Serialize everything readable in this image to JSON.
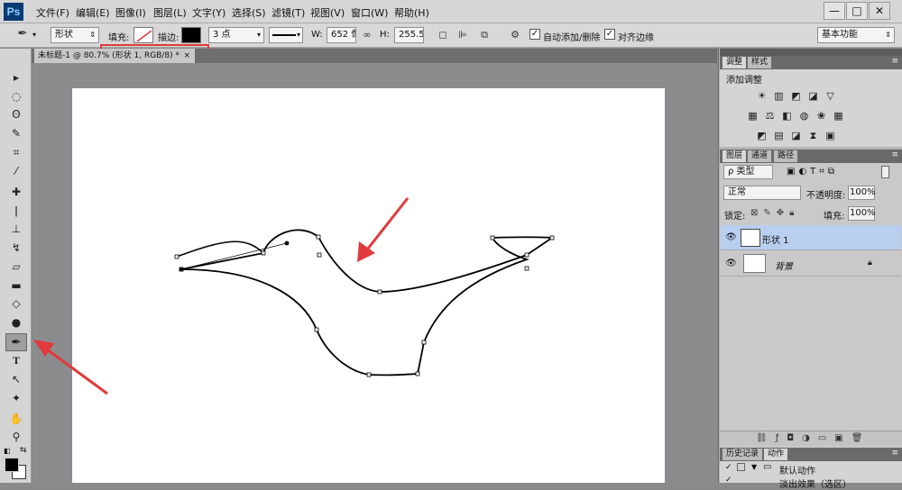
{
  "app": {
    "logo": "Ps"
  },
  "menu": [
    "文件(F)",
    "编辑(E)",
    "图像(I)",
    "图层(L)",
    "文字(Y)",
    "选择(S)",
    "滤镜(T)",
    "视图(V)",
    "窗口(W)",
    "帮助(H)"
  ],
  "window": {
    "minimize": "—",
    "maximize": "□",
    "close": "✕"
  },
  "options": {
    "tool_mode": "形状",
    "fill_label": "填充:",
    "stroke_label": "描边:",
    "stroke_width": "3 点",
    "w_label": "W:",
    "w_value": "652 像",
    "h_label": "H:",
    "h_value": "255.5 t",
    "auto_add_delete": "自动添加/删除",
    "align_edges": "对齐边缘",
    "workspace": "基本功能"
  },
  "document": {
    "tab_title": "未标题-1 @ 80.7% (形状 1, RGB/8) *",
    "tab_close": "×"
  },
  "adjust_panel": {
    "tab_adjust": "调整",
    "tab_styles": "样式",
    "heading": "添加调整"
  },
  "layers_panel": {
    "tabs": [
      "图层",
      "通道",
      "路径"
    ],
    "filter_kind": "ρ 类型",
    "blend_mode": "正常",
    "opacity_label": "不透明度:",
    "opacity_value": "100%",
    "lock_label": "锁定:",
    "fill_label": "填充:",
    "fill_value": "100%",
    "layers": [
      {
        "name": "形状 1",
        "selected": true
      },
      {
        "name": "背景",
        "selected": false
      }
    ]
  },
  "history_panel": {
    "tab_history": "历史记录",
    "tab_actions": "动作",
    "item1": "默认动作",
    "item2": "淡出效果（选区）"
  },
  "colors": {
    "accent_red": "#e03a3a",
    "layer_selected": "#b9cff0"
  }
}
